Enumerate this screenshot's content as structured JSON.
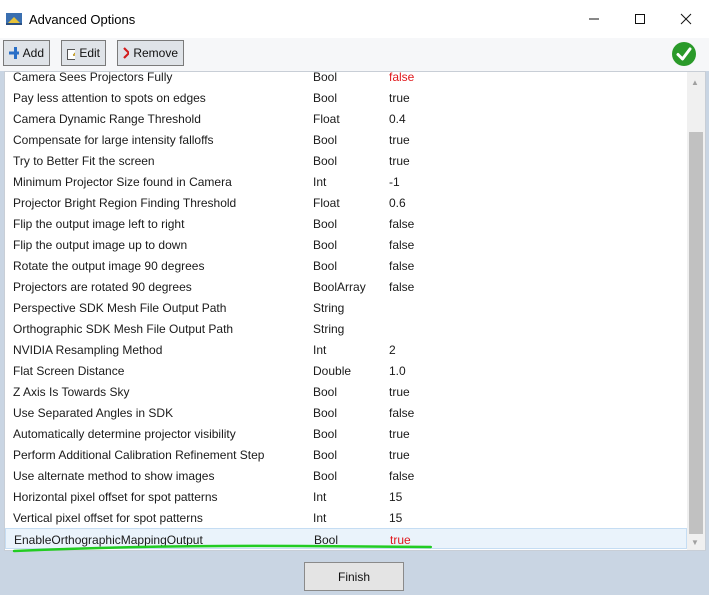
{
  "window": {
    "title": "Advanced Options"
  },
  "toolbar": {
    "add_label": "Add",
    "edit_label": "Edit",
    "remove_label": "Remove"
  },
  "colors": {
    "accent_red": "#e0181c",
    "ok_green": "#2a9a2a",
    "highlight_green": "#22cc22"
  },
  "options": [
    {
      "name": "Camera Sees Projectors Fully",
      "type": "Bool",
      "value": "false",
      "highlight": true
    },
    {
      "name": "Pay less attention to spots on edges",
      "type": "Bool",
      "value": "true"
    },
    {
      "name": "Camera Dynamic Range Threshold",
      "type": "Float",
      "value": "0.4"
    },
    {
      "name": "Compensate for large intensity falloffs",
      "type": "Bool",
      "value": "true"
    },
    {
      "name": "Try to Better Fit the screen",
      "type": "Bool",
      "value": "true"
    },
    {
      "name": "Minimum Projector Size found in Camera",
      "type": "Int",
      "value": "-1"
    },
    {
      "name": "Projector Bright Region Finding Threshold",
      "type": "Float",
      "value": "0.6"
    },
    {
      "name": "Flip the output image left to right",
      "type": "Bool",
      "value": "false"
    },
    {
      "name": "Flip the output image up to down",
      "type": "Bool",
      "value": "false"
    },
    {
      "name": "Rotate the output image 90 degrees",
      "type": "Bool",
      "value": "false"
    },
    {
      "name": "Projectors are rotated 90 degrees",
      "type": "BoolArray",
      "value": "false"
    },
    {
      "name": "Perspective SDK Mesh File Output Path",
      "type": "String",
      "value": ""
    },
    {
      "name": "Orthographic SDK Mesh File Output Path",
      "type": "String",
      "value": ""
    },
    {
      "name": "NVIDIA Resampling Method",
      "type": "Int",
      "value": "2"
    },
    {
      "name": "Flat Screen Distance",
      "type": "Double",
      "value": "1.0"
    },
    {
      "name": "Z Axis Is Towards Sky",
      "type": "Bool",
      "value": "true"
    },
    {
      "name": "Use Separated Angles in SDK",
      "type": "Bool",
      "value": "false"
    },
    {
      "name": "Automatically determine projector visibility",
      "type": "Bool",
      "value": "true"
    },
    {
      "name": "Perform Additional Calibration Refinement Step",
      "type": "Bool",
      "value": "true"
    },
    {
      "name": "Use alternate method to show images",
      "type": "Bool",
      "value": "false"
    },
    {
      "name": "Horizontal pixel offset for spot patterns",
      "type": "Int",
      "value": "15"
    },
    {
      "name": "Vertical pixel offset for spot patterns",
      "type": "Int",
      "value": "15"
    },
    {
      "name": "EnableOrthographicMappingOutput",
      "type": "Bool",
      "value": "true",
      "highlight": true,
      "selected": true
    }
  ],
  "footer": {
    "finish_label": "Finish"
  }
}
